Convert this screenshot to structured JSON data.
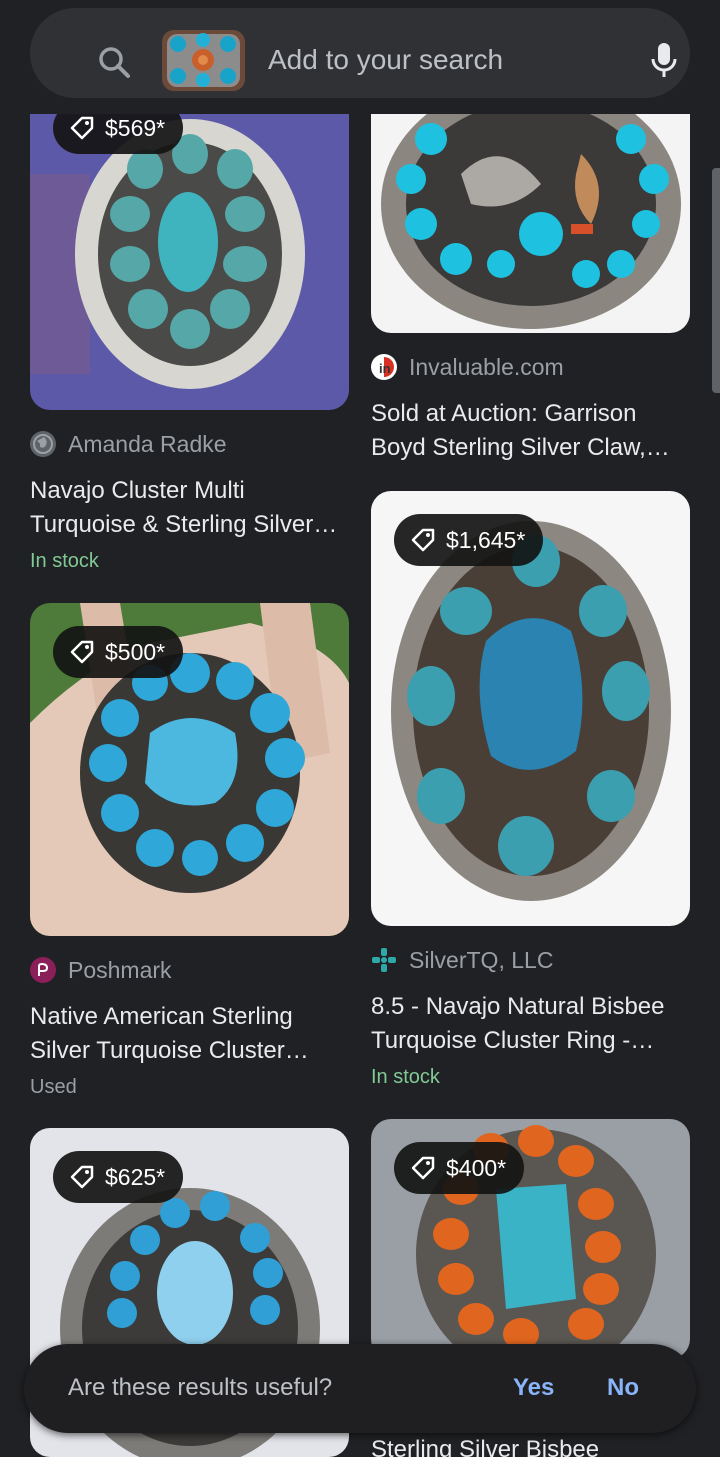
{
  "search": {
    "placeholder": "Add to your search",
    "icons": [
      "search-icon",
      "image-thumbnail",
      "mic-icon"
    ]
  },
  "results": [
    {
      "price": "$569*",
      "source": "Amanda Radke",
      "source_icon": "globe-icon",
      "title": "Navajo Cluster Multi Turquoise & Sterling Silver…",
      "status": "In stock"
    },
    {
      "source": "Invaluable.com",
      "source_icon": "invaluable-logo",
      "title": "Sold at Auction: Garrison Boyd Sterling Silver Claw,…"
    },
    {
      "price": "$500*",
      "source": "Poshmark",
      "source_icon": "poshmark-logo",
      "title": "Native American Sterling Silver Turquoise Cluster…",
      "status": "Used"
    },
    {
      "price": "$1,645*",
      "source": "SilverTQ, LLC",
      "source_icon": "silvertq-logo",
      "title": "8.5 - Navajo Natural Bisbee Turquoise Cluster Ring -…",
      "status": "In stock"
    },
    {
      "price": "$625*"
    },
    {
      "price": "$400*",
      "title": "Sterling Silver Bisbee"
    }
  ],
  "feedback": {
    "question": "Are these results useful?",
    "yes": "Yes",
    "no": "No"
  },
  "colors": {
    "background": "#202124",
    "link_blue": "#8ab4f8",
    "stock_green": "#81c995"
  }
}
